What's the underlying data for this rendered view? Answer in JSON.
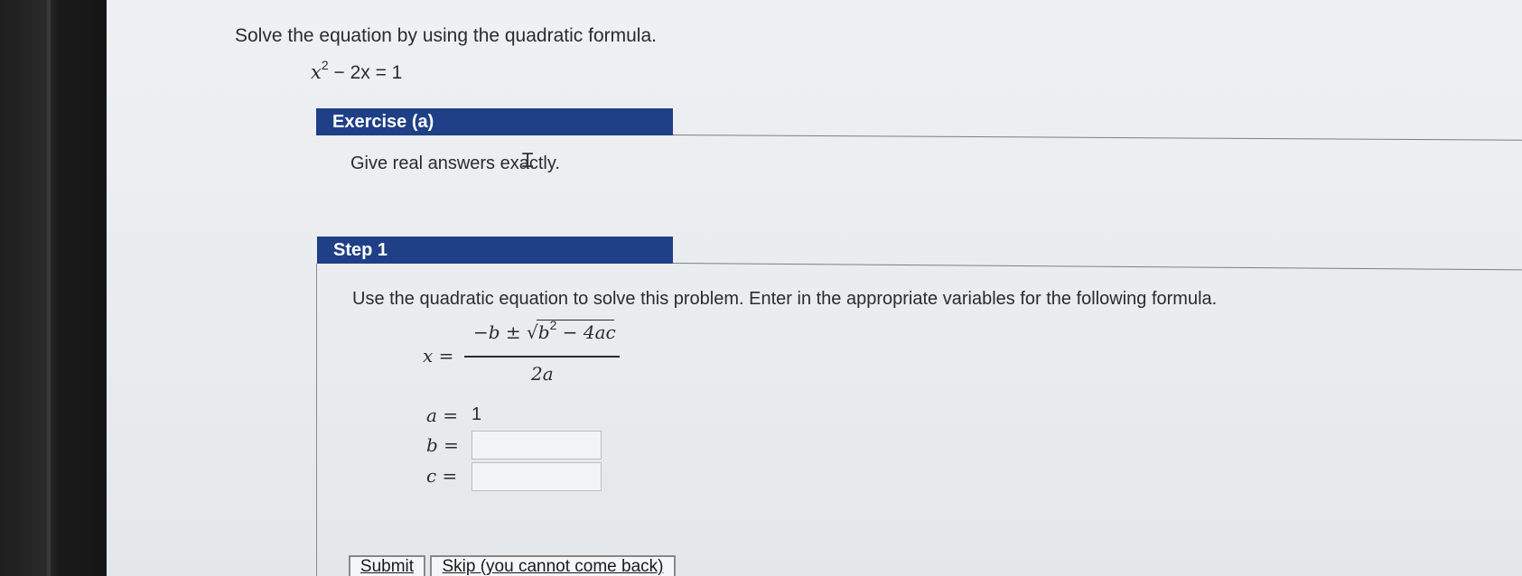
{
  "question": {
    "prompt": "Solve the equation by using the quadratic formula.",
    "equation": {
      "lhs_var": "x",
      "exponent": "2",
      "rest": " − 2x = 1"
    }
  },
  "exercise": {
    "header": "Exercise (a)",
    "instruction": "Give real answers exactly."
  },
  "step": {
    "header": "Step 1",
    "text": "Use the quadratic equation to solve this problem. Enter in the appropriate variables for the following formula.",
    "formula": {
      "lhs": "x =",
      "numerator": "−b ± √",
      "radicand": "b",
      "radicand_exp": "2",
      "radicand_rest": " − 4ac",
      "denominator": "2a"
    },
    "variables": {
      "a_label": "a =",
      "a_value": "1",
      "b_label": "b =",
      "b_value": "",
      "c_label": "c =",
      "c_value": ""
    }
  },
  "buttons": {
    "submit": "Submit",
    "skip": "Skip (you cannot come back)"
  },
  "icons": {
    "cursor": "text-cursor-icon"
  },
  "colors": {
    "header_bg": "#1f3f86",
    "header_text": "#ffffff"
  }
}
